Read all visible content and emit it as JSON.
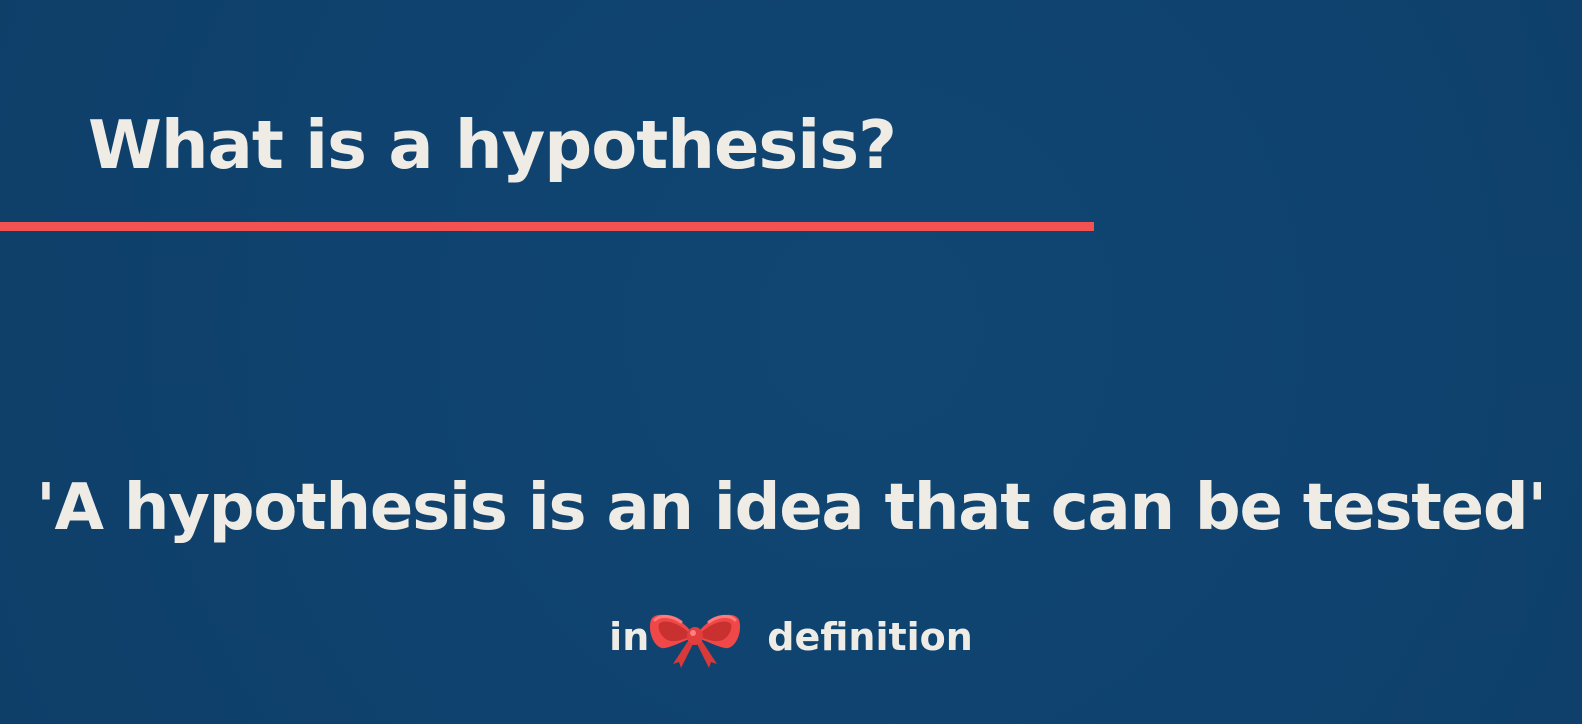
{
  "slide": {
    "title": "What is a hypothesis?",
    "quote": "'A hypothesis is an idea that can be tested'",
    "caption_before": "in",
    "caption_after": "definition",
    "bow_icon": "red-bow-icon"
  },
  "colors": {
    "background": "#0f426e",
    "accent": "#f25252",
    "text": "#efece6"
  }
}
